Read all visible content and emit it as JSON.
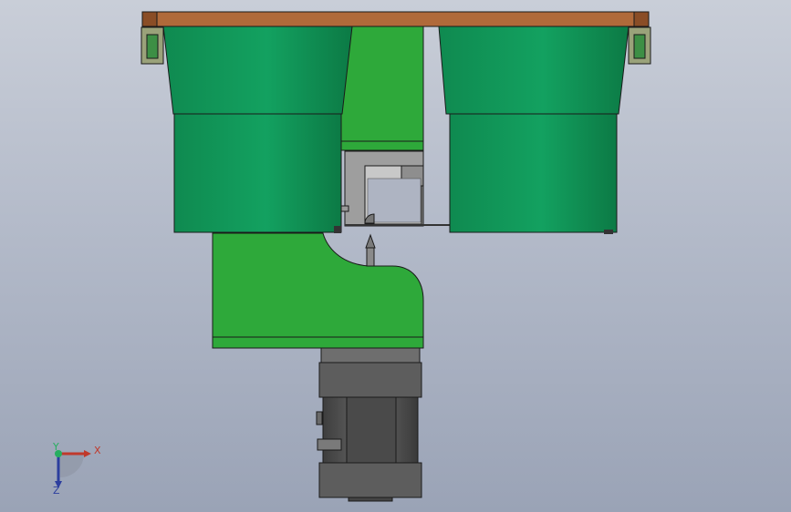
{
  "viewport": {
    "colors": {
      "bg_top": "#c9ced8",
      "bg_bottom": "#9aa3b6",
      "plate": "#b06a3a",
      "bowl_green": "#12975a",
      "frame_green": "#2ea93a",
      "metal_dark": "#5a5a5a",
      "metal_mid": "#7a7a7a",
      "outline": "#1a1a1a"
    }
  },
  "triad": {
    "x_label": "X",
    "y_label": "Y",
    "z_label": "Z",
    "x_color": "#c0392b",
    "y_color": "#27ae60",
    "z_color": "#2c3e9e"
  }
}
